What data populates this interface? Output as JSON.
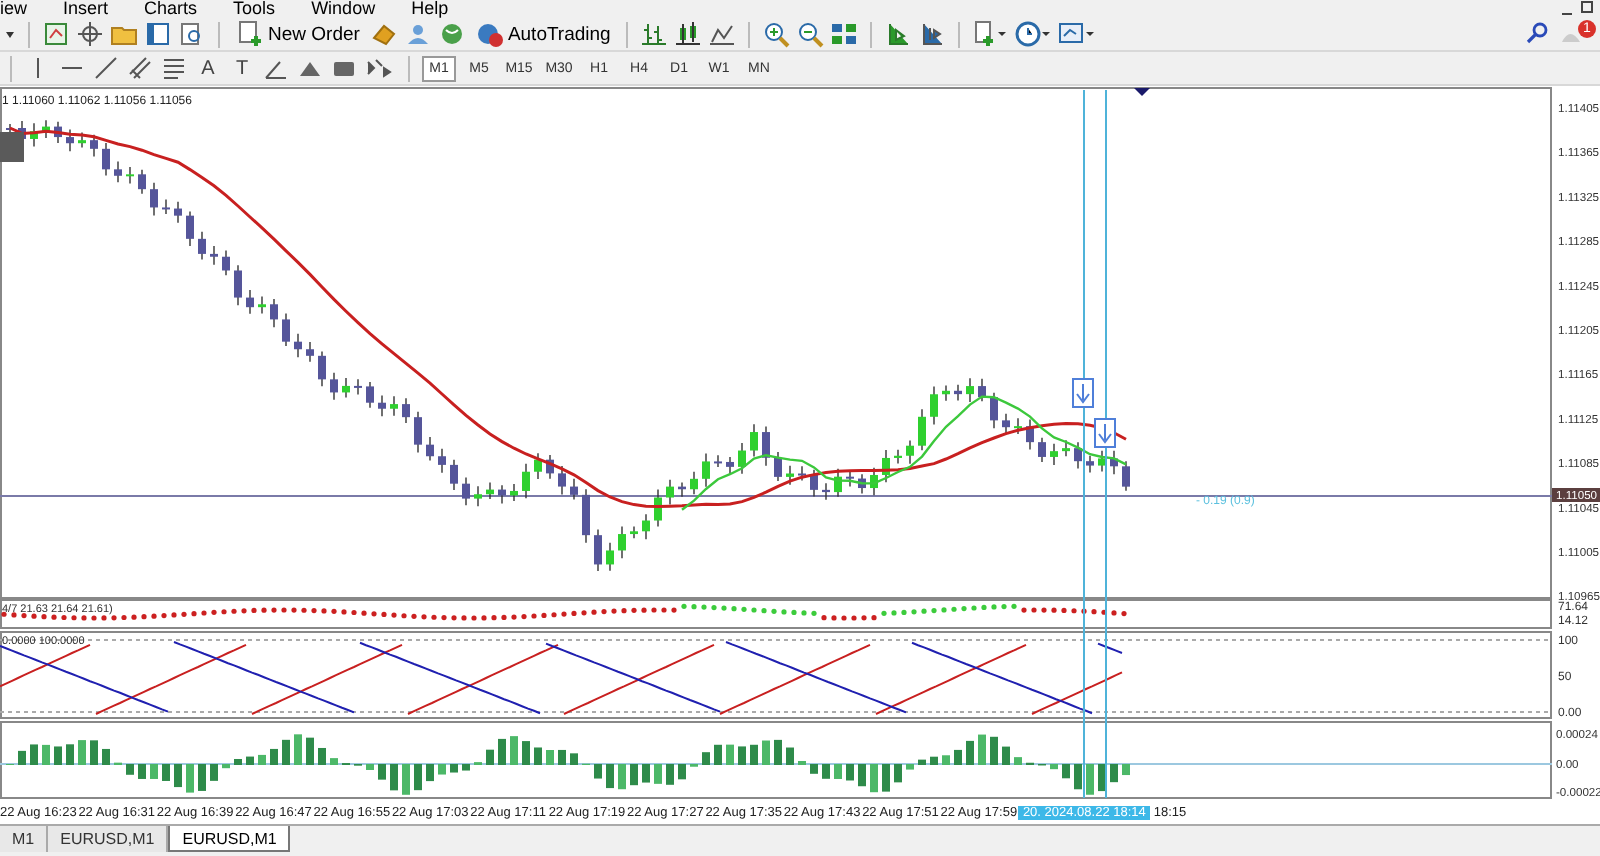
{
  "menu": [
    "iew",
    "Insert",
    "Charts",
    "Tools",
    "Window",
    "Help"
  ],
  "toolbar": {
    "new_order": "New Order",
    "auto_trading": "AutoTrading",
    "notification_count": "1"
  },
  "drawing_tools": [
    {
      "kind": "vline"
    },
    {
      "kind": "hline"
    },
    {
      "kind": "trendline"
    },
    {
      "kind": "channel"
    },
    {
      "kind": "fibo"
    },
    {
      "kind": "glyph",
      "glyph": "A"
    },
    {
      "kind": "glyph",
      "glyph": "T"
    },
    {
      "kind": "arrow-mark"
    },
    {
      "kind": "triangle"
    },
    {
      "kind": "rectangle"
    },
    {
      "kind": "arrows-dropdown"
    }
  ],
  "timeframes": [
    {
      "label": "M1",
      "selected": true
    },
    {
      "label": "M5",
      "selected": false
    },
    {
      "label": "M15",
      "selected": false
    },
    {
      "label": "M30",
      "selected": false
    },
    {
      "label": "H1",
      "selected": false
    },
    {
      "label": "H4",
      "selected": false
    },
    {
      "label": "D1",
      "selected": false
    },
    {
      "label": "W1",
      "selected": false
    },
    {
      "label": "MN",
      "selected": false
    }
  ],
  "chart": {
    "ohlc": "1 1.11060 1.11062 1.11056 1.11056",
    "price_labels": [
      "1.11405",
      "1.11365",
      "1.11325",
      "1.11285",
      "1.11245",
      "1.11205",
      "1.11165",
      "1.11125",
      "1.11085",
      "1.11045",
      "1.11005",
      "1.10965"
    ],
    "current_price": "1.11050",
    "trade_label": "- 0.19 (0.9)",
    "pane_1": {
      "label": "4/7 21.63 21.64 21.61)",
      "axis_labels": [
        "71.64",
        "14.12"
      ]
    },
    "pane_2": {
      "label": "0.0000 100.0000",
      "axis_labels": [
        "100",
        "50",
        "0.00"
      ]
    },
    "pane_3": {
      "axis_labels": [
        "0.00024",
        "0.00",
        "-0.00022"
      ]
    }
  },
  "time_labels": [
    "22 Aug 16:23",
    "22 Aug 16:31",
    "22 Aug 16:39",
    "22 Aug 16:47",
    "22 Aug 16:55",
    "22 Aug 17:03",
    "22 Aug 17:11",
    "22 Aug 17:19",
    "22 Aug 17:27",
    "22 Aug 17:35",
    "22 Aug 17:43",
    "22 Aug 17:51",
    "22 Aug 17:59"
  ],
  "cursor_time": "20. 2024.08.22 18:14",
  "last_time": "18:15",
  "tabs": [
    {
      "label": "M1",
      "selected": false
    },
    {
      "label": "EURUSD,M1",
      "selected": false
    },
    {
      "label": "EURUSD,M1",
      "selected": true
    }
  ]
}
